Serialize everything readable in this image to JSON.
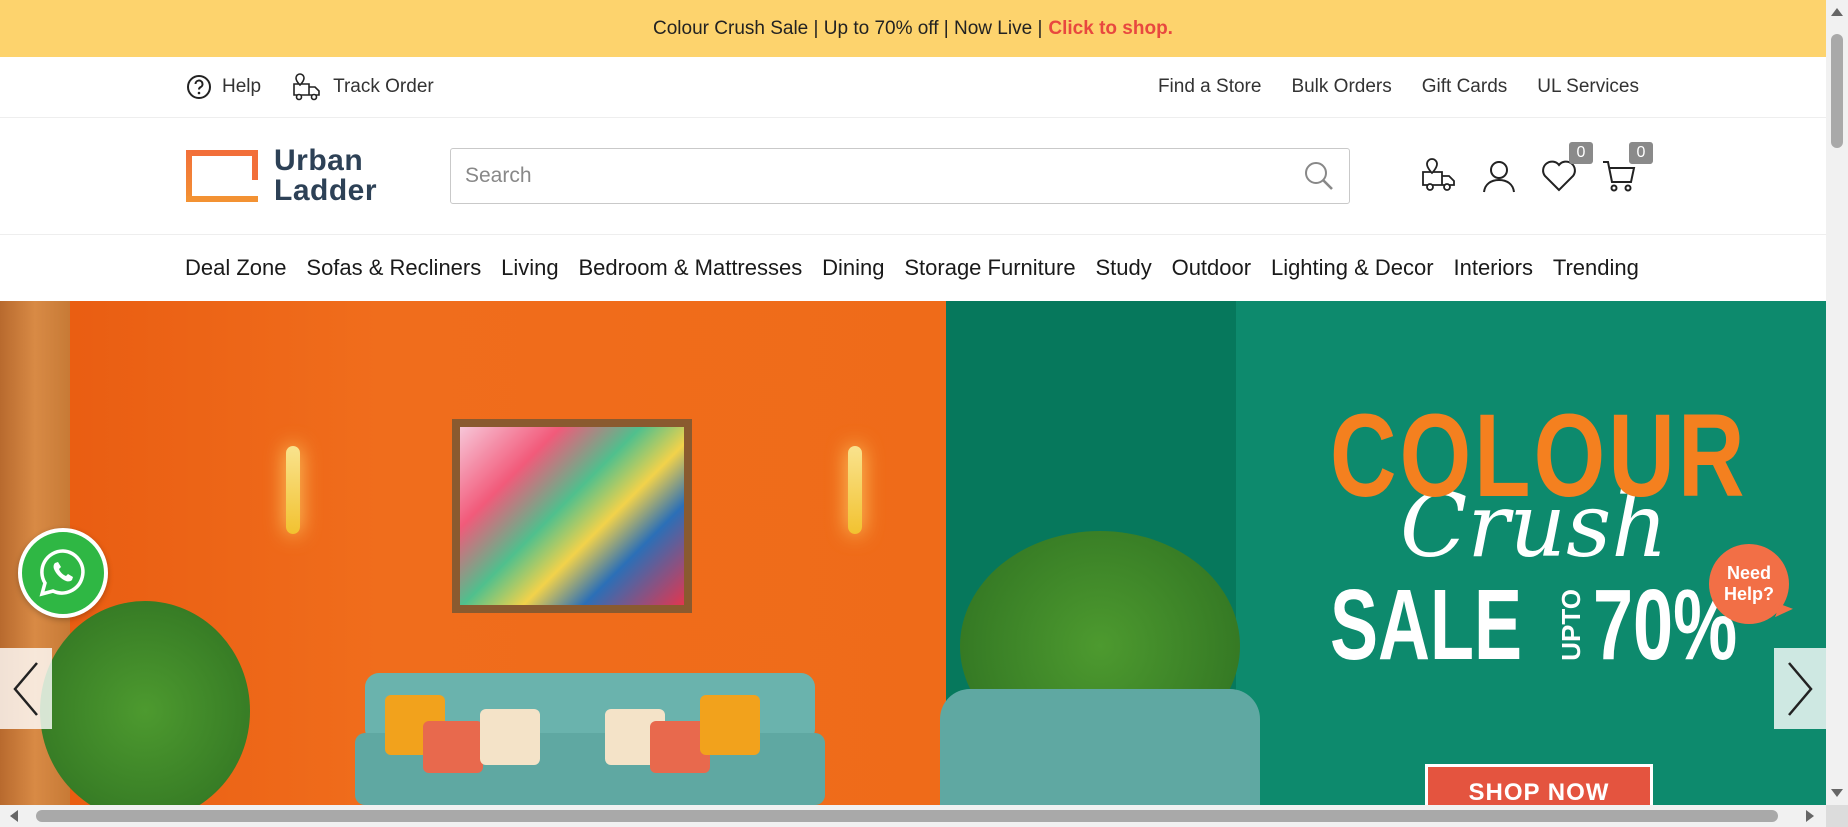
{
  "promo_bar": {
    "text": "Colour Crush Sale | Up to 70% off | Now Live |",
    "cta": "Click to shop."
  },
  "utility_bar": {
    "help": "Help",
    "track_order": "Track Order",
    "links": [
      "Find a Store",
      "Bulk Orders",
      "Gift Cards",
      "UL Services"
    ]
  },
  "header": {
    "logo_line1": "Urban",
    "logo_line2": "Ladder",
    "search_placeholder": "Search",
    "wishlist_count": "0",
    "cart_count": "0"
  },
  "nav": {
    "items": [
      "Deal Zone",
      "Sofas & Recliners",
      "Living",
      "Bedroom & Mattresses",
      "Dining",
      "Storage Furniture",
      "Study",
      "Outdoor",
      "Lighting & Decor",
      "Interiors",
      "Trending"
    ]
  },
  "hero": {
    "title": "COLOUR",
    "script": "Crush",
    "sale": "SALE",
    "upto": "UPTO",
    "percent": "70%",
    "shop_button": "SHOP NOW"
  },
  "widgets": {
    "need_help": "Need Help?"
  },
  "colors": {
    "promo_bg": "#fdd36d",
    "cta": "#e8483f",
    "brand_orange": "#f26f3a",
    "brand_navy": "#2d4156",
    "hero_green": "#0d8a6d",
    "hero_orange": "#f06d1c"
  }
}
